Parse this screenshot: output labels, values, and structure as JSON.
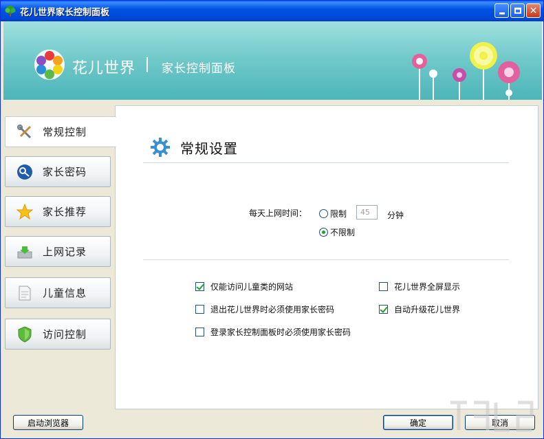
{
  "window": {
    "title": "花儿世界家长控制面板"
  },
  "banner": {
    "brand": "花儿世界",
    "subtitle": "家长控制面板"
  },
  "nav": {
    "items": [
      {
        "label": "常规控制",
        "icon": "tools-icon",
        "active": true
      },
      {
        "label": "家长密码",
        "icon": "key-icon"
      },
      {
        "label": "家长推荐",
        "icon": "star-icon"
      },
      {
        "label": "上网记录",
        "icon": "inbox-icon"
      },
      {
        "label": "儿童信息",
        "icon": "document-icon"
      },
      {
        "label": "访问控制",
        "icon": "shield-icon"
      }
    ]
  },
  "section": {
    "title": "常规设置",
    "icon": "gear-icon"
  },
  "time_limit": {
    "label": "每天上网时间：",
    "limit_label": "限制",
    "minutes_value": "45",
    "minutes_unit": "分钟",
    "unlimited_label": "不限制",
    "selected": "unlimited"
  },
  "options": [
    {
      "label": "仅能访问儿童类的网站",
      "checked": true
    },
    {
      "label": "花儿世界全屏显示",
      "checked": false
    },
    {
      "label": "退出花儿世界时必须使用家长密码",
      "checked": false
    },
    {
      "label": "自动升级花儿世界",
      "checked": true
    },
    {
      "label": "登录家长控制面板时必须使用家长密码",
      "checked": false
    }
  ],
  "footer": {
    "launch_browser": "启动浏览器",
    "ok": "确定",
    "cancel": "取消"
  },
  "colors": {
    "titlebar": "#0054e3",
    "banner": "#6fc8c9",
    "check": "#21a121"
  }
}
